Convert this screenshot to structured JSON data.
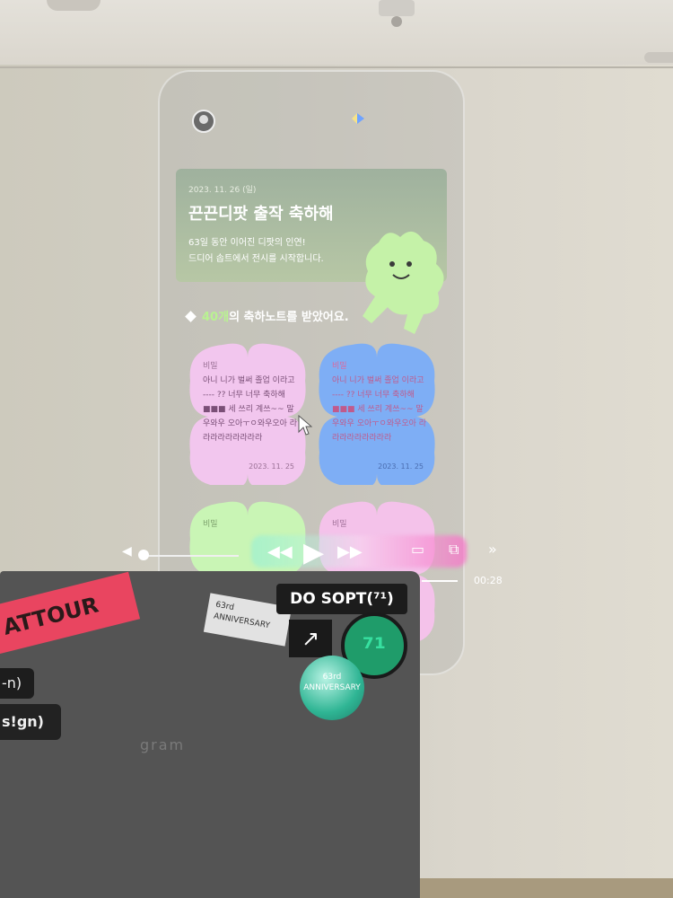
{
  "phone_app": {
    "banner": {
      "date": "2023. 11. 26 (일)",
      "title": "끈끈디팟 출작 축하해",
      "desc_line1": "63일 동안 이어진 디팟의 인연!",
      "desc_line2": "드디어 솝트에서 전시를 시작합니다."
    },
    "section": {
      "count": "40개",
      "title_rest": "의 축하노트를 받았어요."
    },
    "notes": [
      {
        "name": "비밀",
        "body": "아니 니가 벌써 졸업 이라고 ---- ?? 너무 너무 축하해 ■■■ 세 쓰리 계쓰~~ 말 우와우 오아ㅜㅇ와우오아 라라라라라라라라라",
        "date": "2023. 11. 25",
        "color": "#f2c6ee"
      },
      {
        "name": "비밀",
        "body": "아니 니가 벌써 졸업 이라고 ---- ?? 너무 너무 축하해 ■■■ 세 쓰리 계쓰~~ 말 우와우 오아ㅜㅇ와우오아 라라라라라라라라라",
        "date": "2023. 11. 25",
        "color": "#7eaef5"
      },
      {
        "name": "비밀",
        "color": "#c9f5b5"
      },
      {
        "name": "비밀",
        "color": "#f4c2ea"
      }
    ]
  },
  "player": {
    "time": "00:28"
  },
  "stickers": {
    "red": "ATTOUR",
    "n": "-n)",
    "sign": "s!gn)",
    "dosopt": "DO SOPT(⁷¹)",
    "anniv_line1": "63rd",
    "anniv_line2": "ANNIVERSARY",
    "arrow": "↗",
    "green_circle": "⁷¹",
    "holo_line1": "63rd",
    "holo_line2": "ANNIVERSARY"
  },
  "laptop": {
    "logo": "gram"
  }
}
